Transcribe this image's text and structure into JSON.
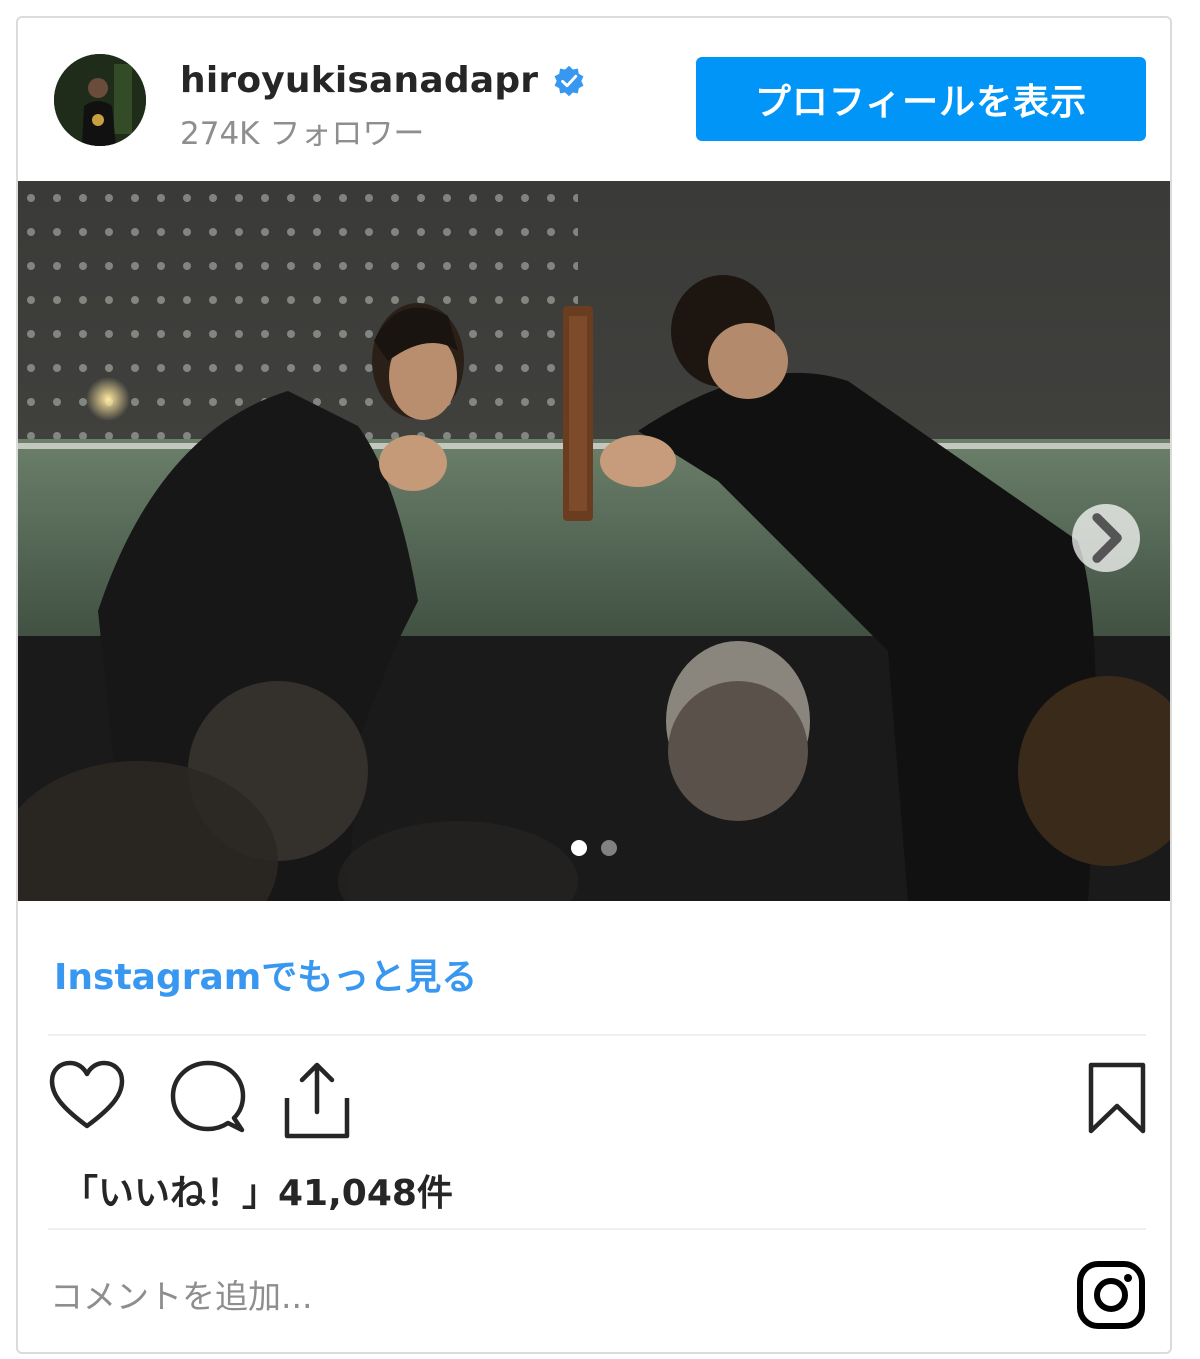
{
  "header": {
    "username": "hiroyukisanadapr",
    "verified": true,
    "followers": "274K フォロワー",
    "profile_button": "プロフィールを表示"
  },
  "post": {
    "image_alt": "photo",
    "carousel_index": 1,
    "carousel_total": 2,
    "next_icon": "chevron-right-icon"
  },
  "more_link": "Instagramでもっと見る",
  "actions": {
    "icons": [
      "heart-icon",
      "comment-icon",
      "share-icon",
      "bookmark-icon"
    ]
  },
  "likes_label": "「いいね！」41,048件",
  "comment_placeholder": "コメントを追加...",
  "colors": {
    "accent": "#0095f6",
    "link": "#3897f0",
    "border": "#dbdbdb",
    "text": "#262626",
    "muted": "#8e8e8e"
  }
}
